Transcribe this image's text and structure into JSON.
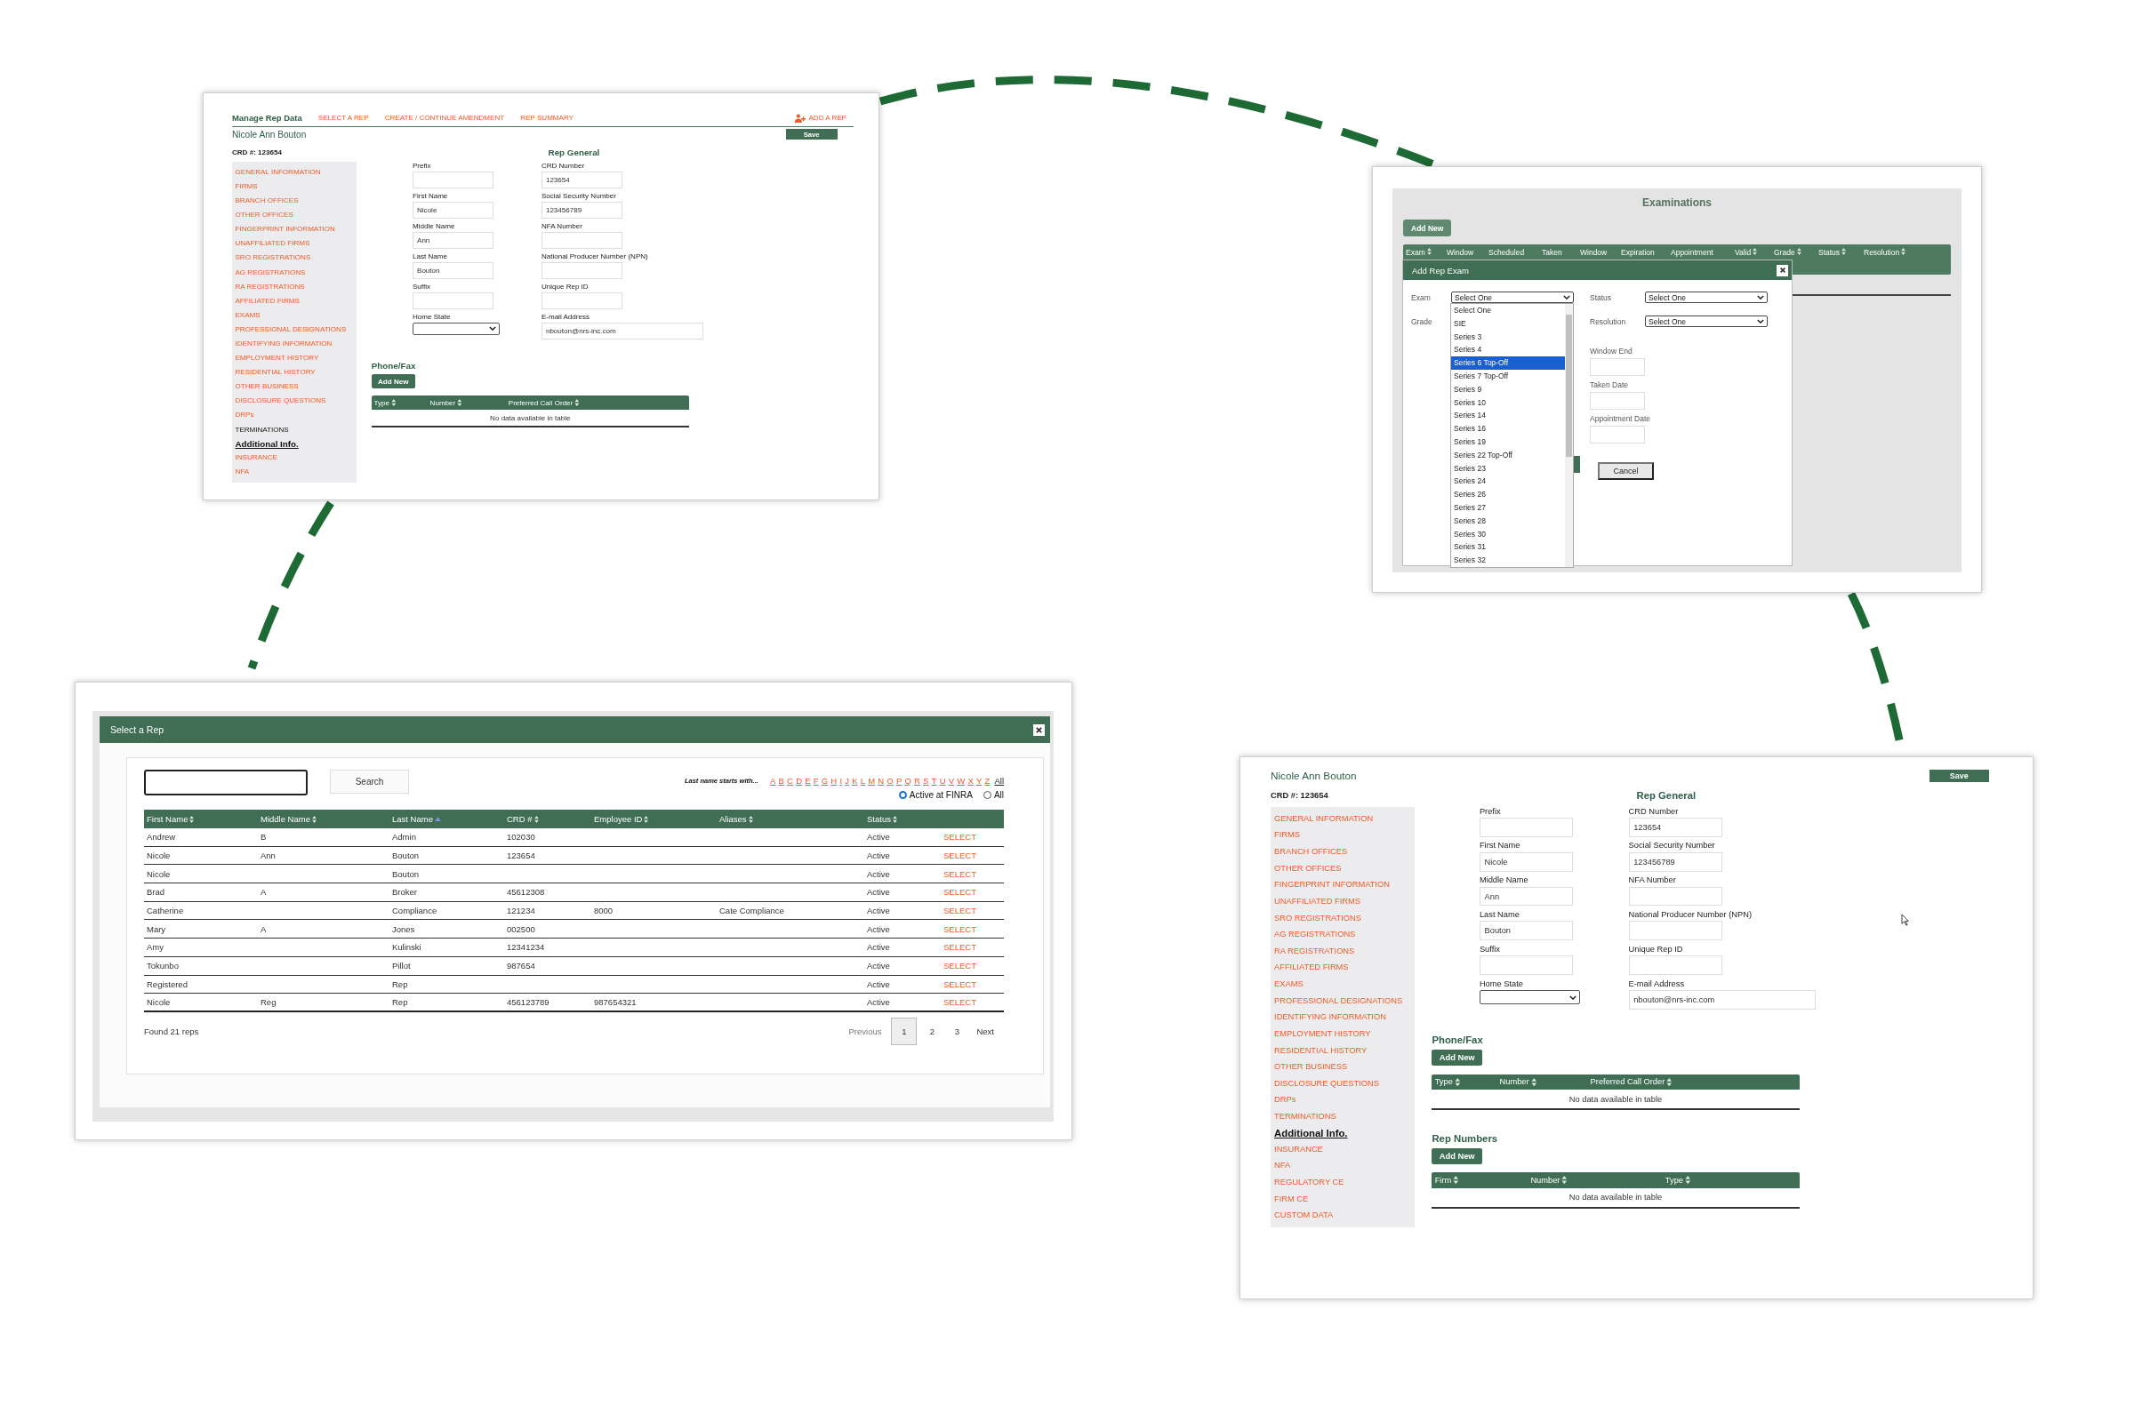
{
  "manage_rep_screen": {
    "nav": {
      "title": "Manage Rep Data",
      "links": [
        "SELECT A REP",
        "CREATE / CONTINUE AMENDMENT",
        "REP SUMMARY"
      ],
      "add_rep": "ADD A REP"
    },
    "rep_name": "Nicole Ann Bouton",
    "save_button": "Save",
    "crd": "CRD #: 123654",
    "sidebar": [
      {
        "label": "GENERAL INFORMATION",
        "selected": false,
        "hovered": false
      },
      {
        "label": "FIRMS",
        "selected": false,
        "hovered": false
      },
      {
        "label": "BRANCH OFFICES",
        "selected": false,
        "hovered": false
      },
      {
        "label": "OTHER OFFICES",
        "selected": false,
        "hovered": false
      },
      {
        "label": "FINGERPRINT INFORMATION",
        "selected": false,
        "hovered": false
      },
      {
        "label": "UNAFFILIATED FIRMS",
        "selected": false,
        "hovered": false
      },
      {
        "label": "SRO REGISTRATIONS",
        "selected": false,
        "hovered": false
      },
      {
        "label": "AG REGISTRATIONS",
        "selected": false,
        "hovered": false
      },
      {
        "label": "RA REGISTRATIONS",
        "selected": false,
        "hovered": false
      },
      {
        "label": "AFFILIATED FIRMS",
        "selected": false,
        "hovered": false
      },
      {
        "label": "EXAMS",
        "selected": false,
        "hovered": false
      },
      {
        "label": "PROFESSIONAL DESIGNATIONS",
        "selected": false,
        "hovered": false
      },
      {
        "label": "IDENTIFYING INFORMATION",
        "selected": false,
        "hovered": false
      },
      {
        "label": "EMPLOYMENT HISTORY",
        "selected": false,
        "hovered": false
      },
      {
        "label": "RESIDENTIAL HISTORY",
        "selected": false,
        "hovered": false
      },
      {
        "label": "OTHER BUSINESS",
        "selected": false,
        "hovered": false
      },
      {
        "label": "DISCLOSURE QUESTIONS",
        "selected": false,
        "hovered": false
      },
      {
        "label": "DRPs",
        "selected": false,
        "hovered": false
      },
      {
        "label": "TERMINATIONS",
        "selected": false,
        "hovered": true
      },
      {
        "label": "Additional Info.",
        "selected": true,
        "hovered": false
      },
      {
        "label": "INSURANCE",
        "selected": false,
        "hovered": false
      },
      {
        "label": "NFA",
        "selected": false,
        "hovered": false
      }
    ],
    "section_title": "Rep General",
    "fields_left": [
      {
        "label": "Prefix",
        "kind": "text"
      },
      {
        "label": "First Name",
        "kind": "text",
        "value": "Nicole"
      },
      {
        "label": "Middle Name",
        "kind": "text",
        "value": "Ann"
      },
      {
        "label": "Last Name",
        "kind": "text",
        "value": "Bouton"
      },
      {
        "label": "Suffix",
        "kind": "text"
      },
      {
        "label": "Home State",
        "kind": "select"
      }
    ],
    "fields_right": [
      {
        "label": "CRD Number",
        "kind": "text",
        "value": "123654"
      },
      {
        "label": "Social Security Number",
        "kind": "text",
        "value": "123456789"
      },
      {
        "label": "NFA Number",
        "kind": "text"
      },
      {
        "label": "National Producer Number (NPN)",
        "kind": "text"
      },
      {
        "label": "Unique Rep ID",
        "kind": "text"
      },
      {
        "label": "E-mail Address",
        "kind": "wide",
        "value": "nbouton@nrs-inc.com"
      }
    ],
    "phone_fax": {
      "title": "Phone/Fax",
      "add_button": "Add New",
      "columns": [
        "Type",
        "Number",
        "Preferred Call Order"
      ],
      "empty_message": "No data available in table"
    }
  },
  "examinations_screen": {
    "title": "Examinations",
    "add_button": "Add New",
    "columns": [
      {
        "label": "Exam",
        "sortable": true
      },
      {
        "label": "Window",
        "sortable": false
      },
      {
        "label": "Scheduled",
        "sortable": false
      },
      {
        "label": "Taken",
        "sortable": false
      },
      {
        "label": "Window",
        "sortable": false
      },
      {
        "label": "Expiration",
        "sortable": false
      },
      {
        "label": "Appointment",
        "sortable": false
      },
      {
        "label": "Valid",
        "sortable": true
      },
      {
        "label": "Grade",
        "sortable": true
      },
      {
        "label": "Status",
        "sortable": true
      },
      {
        "label": "Resolution",
        "sortable": true
      }
    ],
    "dialog": {
      "title": "Add Rep Exam",
      "exam_label": "Exam",
      "exam_value": "Select One",
      "grade_label": "Grade",
      "options": [
        {
          "label": "Select One",
          "selected": false
        },
        {
          "label": "SIE",
          "selected": false
        },
        {
          "label": "Series 3",
          "selected": false
        },
        {
          "label": "Series 4",
          "selected": false
        },
        {
          "label": "Series 6 Top-Off",
          "selected": true
        },
        {
          "label": "Series 7 Top-Off",
          "selected": false
        },
        {
          "label": "Series 9",
          "selected": false
        },
        {
          "label": "Series 10",
          "selected": false
        },
        {
          "label": "Series 14",
          "selected": false
        },
        {
          "label": "Series 16",
          "selected": false
        },
        {
          "label": "Series 19",
          "selected": false
        },
        {
          "label": "Series 22 Top-Off",
          "selected": false
        },
        {
          "label": "Series 23",
          "selected": false
        },
        {
          "label": "Series 24",
          "selected": false
        },
        {
          "label": "Series 26",
          "selected": false
        },
        {
          "label": "Series 27",
          "selected": false
        },
        {
          "label": "Series 28",
          "selected": false
        },
        {
          "label": "Series 30",
          "selected": false
        },
        {
          "label": "Series 31",
          "selected": false
        },
        {
          "label": "Series 32",
          "selected": false
        }
      ],
      "selects": [
        {
          "label": "Status",
          "value": "Select One"
        },
        {
          "label": "Resolution",
          "value": "Select One"
        }
      ],
      "date_fields": [
        "Window End",
        "Taken Date",
        "Appointment Date"
      ],
      "cancel_button": "Cancel"
    }
  },
  "select_rep_screen": {
    "title": "Select a Rep",
    "search_button": "Search",
    "letters_label": "Last name starts with...",
    "letters": [
      "A",
      "B",
      "C",
      "D",
      "E",
      "F",
      "G",
      "H",
      "I",
      "J",
      "K",
      "L",
      "M",
      "N",
      "O",
      "P",
      "Q",
      "R",
      "S",
      "T",
      "U",
      "V",
      "W",
      "X",
      "Y",
      "Z"
    ],
    "all_letters": "All",
    "radios": [
      {
        "label": "Active at FINRA",
        "selected": true
      },
      {
        "label": "All",
        "selected": false
      }
    ],
    "columns": [
      {
        "label": "First Name",
        "sorted": false
      },
      {
        "label": "Middle Name",
        "sorted": false
      },
      {
        "label": "Last Name",
        "sorted": true
      },
      {
        "label": "CRD #",
        "sorted": false
      },
      {
        "label": "Employee ID",
        "sorted": false
      },
      {
        "label": "Aliases",
        "sorted": false
      },
      {
        "label": "Status",
        "sorted": false
      }
    ],
    "rows": [
      {
        "cells": [
          "Andrew",
          "B",
          "Admin",
          "102030",
          "",
          "",
          "Active"
        ],
        "action": "SELECT"
      },
      {
        "cells": [
          "Nicole",
          "Ann",
          "Bouton",
          "123654",
          "",
          "",
          "Active"
        ],
        "action": "SELECT"
      },
      {
        "cells": [
          "Nicole",
          "",
          "Bouton",
          "",
          "",
          "",
          "Active"
        ],
        "action": "SELECT"
      },
      {
        "cells": [
          "Brad",
          "A",
          "Broker",
          "45612308",
          "",
          "",
          "Active"
        ],
        "action": "SELECT"
      },
      {
        "cells": [
          "Catherine",
          "",
          "Compliance",
          "121234",
          "8000",
          "Cate Compliance",
          "Active"
        ],
        "action": "SELECT"
      },
      {
        "cells": [
          "Mary",
          "A",
          "Jones",
          "002500",
          "",
          "",
          "Active"
        ],
        "action": "SELECT"
      },
      {
        "cells": [
          "Amy",
          "",
          "Kulinski",
          "12341234",
          "",
          "",
          "Active"
        ],
        "action": "SELECT"
      },
      {
        "cells": [
          "Tokunbo",
          "",
          "Pillot",
          "987654",
          "",
          "",
          "Active"
        ],
        "action": "SELECT"
      },
      {
        "cells": [
          "Registered",
          "",
          "Rep",
          "",
          "",
          "",
          "Active"
        ],
        "action": "SELECT"
      },
      {
        "cells": [
          "Nicole",
          "Reg",
          "Rep",
          "456123789",
          "987654321",
          "",
          "Active"
        ],
        "action": "SELECT"
      }
    ],
    "found": "Found 21 reps",
    "previous": "Previous",
    "pages": [
      {
        "label": "1",
        "selected": true
      },
      {
        "label": "2",
        "selected": false
      },
      {
        "label": "3",
        "selected": false
      }
    ],
    "next": "Next"
  },
  "rep_detail_screen": {
    "rep_name": "Nicole Ann Bouton",
    "save_button": "Save",
    "crd": "CRD #: 123654",
    "sidebar": [
      {
        "label": "GENERAL INFORMATION",
        "selected": false
      },
      {
        "label": "FIRMS",
        "selected": false
      },
      {
        "label": "BRANCH OFFICES",
        "selected": false
      },
      {
        "label": "OTHER OFFICES",
        "selected": false
      },
      {
        "label": "FINGERPRINT INFORMATION",
        "selected": false
      },
      {
        "label": "UNAFFILIATED FIRMS",
        "selected": false
      },
      {
        "label": "SRO REGISTRATIONS",
        "selected": false
      },
      {
        "label": "AG REGISTRATIONS",
        "selected": false
      },
      {
        "label": "RA REGISTRATIONS",
        "selected": false
      },
      {
        "label": "AFFILIATED FIRMS",
        "selected": false
      },
      {
        "label": "EXAMS",
        "selected": false
      },
      {
        "label": "PROFESSIONAL DESIGNATIONS",
        "selected": false
      },
      {
        "label": "IDENTIFYING INFORMATION",
        "selected": false
      },
      {
        "label": "EMPLOYMENT HISTORY",
        "selected": false
      },
      {
        "label": "RESIDENTIAL HISTORY",
        "selected": false
      },
      {
        "label": "OTHER BUSINESS",
        "selected": false
      },
      {
        "label": "DISCLOSURE QUESTIONS",
        "selected": false
      },
      {
        "label": "DRPs",
        "selected": false
      },
      {
        "label": "TERMINATIONS",
        "selected": false
      },
      {
        "label": "Additional Info.",
        "selected": true
      },
      {
        "label": "INSURANCE",
        "selected": false
      },
      {
        "label": "NFA",
        "selected": false
      },
      {
        "label": "REGULATORY CE",
        "selected": false
      },
      {
        "label": "FIRM CE",
        "selected": false
      },
      {
        "label": "CUSTOM DATA",
        "selected": false
      }
    ],
    "section_title": "Rep General",
    "fields_left": [
      {
        "label": "Prefix",
        "kind": "text"
      },
      {
        "label": "First Name",
        "kind": "text",
        "value": "Nicole"
      },
      {
        "label": "Middle Name",
        "kind": "text",
        "value": "Ann"
      },
      {
        "label": "Last Name",
        "kind": "text",
        "value": "Bouton"
      },
      {
        "label": "Suffix",
        "kind": "text"
      },
      {
        "label": "Home State",
        "kind": "select"
      }
    ],
    "fields_right": [
      {
        "label": "CRD Number",
        "kind": "text",
        "value": "123654"
      },
      {
        "label": "Social Security Number",
        "kind": "text",
        "value": "123456789"
      },
      {
        "label": "NFA Number",
        "kind": "text"
      },
      {
        "label": "National Producer Number (NPN)",
        "kind": "text"
      },
      {
        "label": "Unique Rep ID",
        "kind": "text"
      },
      {
        "label": "E-mail Address",
        "kind": "wide",
        "value": "nbouton@nrs-inc.com"
      }
    ],
    "phone_fax": {
      "title": "Phone/Fax",
      "add_button": "Add New",
      "columns": [
        "Type",
        "Number",
        "Preferred Call Order"
      ],
      "empty_message": "No data available in table"
    },
    "rep_numbers": {
      "title": "Rep Numbers",
      "add_button": "Add New",
      "columns": [
        "Firm",
        "Number",
        "Type"
      ],
      "empty_message": "No data available in table"
    }
  }
}
